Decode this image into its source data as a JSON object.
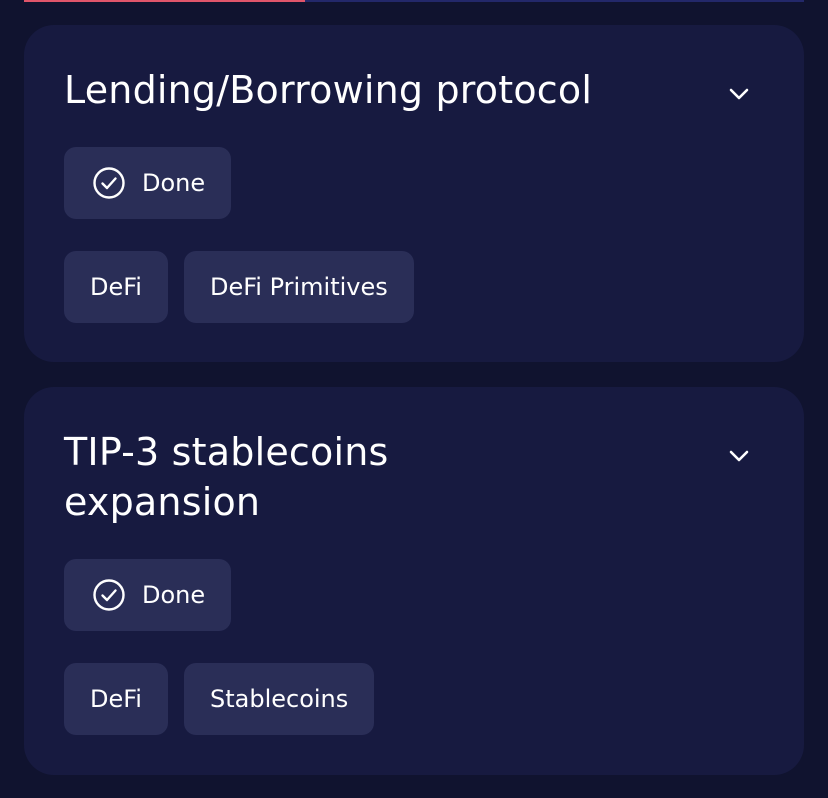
{
  "progress": {
    "fraction": 0.36
  },
  "cards": [
    {
      "title": "Lending/Borrowing protocol",
      "status": {
        "label": "Done",
        "icon": "check-circle-icon"
      },
      "tags": [
        "DeFi",
        "DeFi Primitives"
      ],
      "expand_icon": "chevron-down-icon"
    },
    {
      "title": "TIP-3 stablecoins expansion",
      "status": {
        "label": "Done",
        "icon": "check-circle-icon"
      },
      "tags": [
        "DeFi",
        "Stablecoins"
      ],
      "expand_icon": "chevron-down-icon"
    }
  ],
  "colors": {
    "background": "#10132f",
    "card": "#171a40",
    "chip": "#2a2e57",
    "progress_fill": "#e0556a",
    "progress_track": "#23286a"
  }
}
